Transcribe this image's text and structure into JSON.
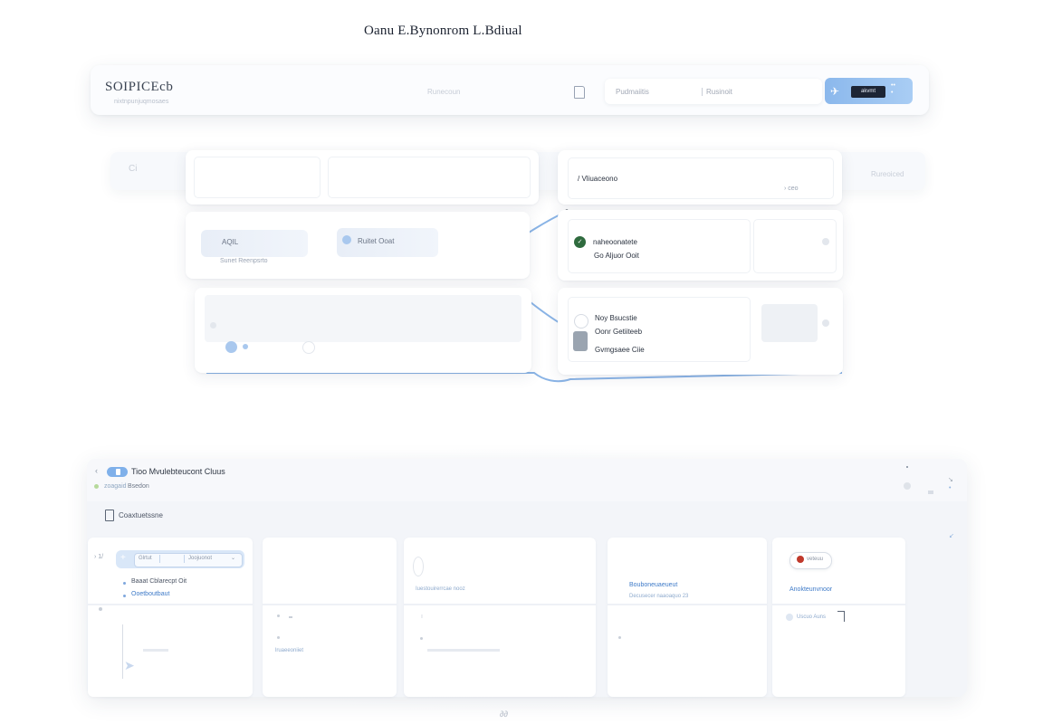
{
  "hero": {
    "title": "Oanu E.Bynonrom L.Bdiual"
  },
  "header": {
    "brand": "SOIPICEcb",
    "brand_sub": "nixtnpunjuqmosaes",
    "search_placeholder": "Runecoun",
    "field_a": "Pudmaiitis",
    "field_b": "Rusinoit",
    "action_label": "akvmt",
    "action_dots": "• •\n•",
    "doc_icon": "doc-icon",
    "send_icon": "send-icon"
  },
  "middle": {
    "ghost_icon_text": "Ci",
    "ghost_button": "Rureoiced",
    "chip_a_label": "AQIL",
    "chip_a_sub": "Sunet Reenpsrto",
    "chip_b_label": "Ruitet Ooat",
    "item_1": "/ Vliuaceono",
    "item_1_meta": "› ceo",
    "item_2_title": "naheoonatete",
    "item_2_sub": "Go Aljuor Ooit",
    "item_3_title": "Noy Bsucstie",
    "item_3_sub": "Oonr Getiiteeb",
    "item_3_extra": "Gvmgsaee Ciie"
  },
  "bottom": {
    "title": "Tioo Mvulebteucont Cluus",
    "status_a": "zoagaid",
    "status_b": "Bsedon",
    "doc_label": "Coaxtuetssne",
    "pill_left": "› 1/",
    "pill_a": "Glrtut",
    "pill_b": "Joojuonot",
    "list_1": "Baaat Cblarecpt Oit",
    "list_2": "Ooetboutbaut",
    "col2_foot": "lruaeeoniiet",
    "col3_link": "Iuestouirerrcae nooz",
    "col4_title": "Bouboneuaeueut",
    "col4_sub": "Decusecer naaoaquo 23",
    "col5_chip": "veteuu",
    "col5_link": "Anokteunvnoor",
    "col5_check": "Uscuo Auns",
    "footer": "∂∂"
  },
  "colors": {
    "accent": "#7fb0ea",
    "line": "#8ab4e6",
    "danger": "#c0392b",
    "success": "#2f6b3e"
  }
}
